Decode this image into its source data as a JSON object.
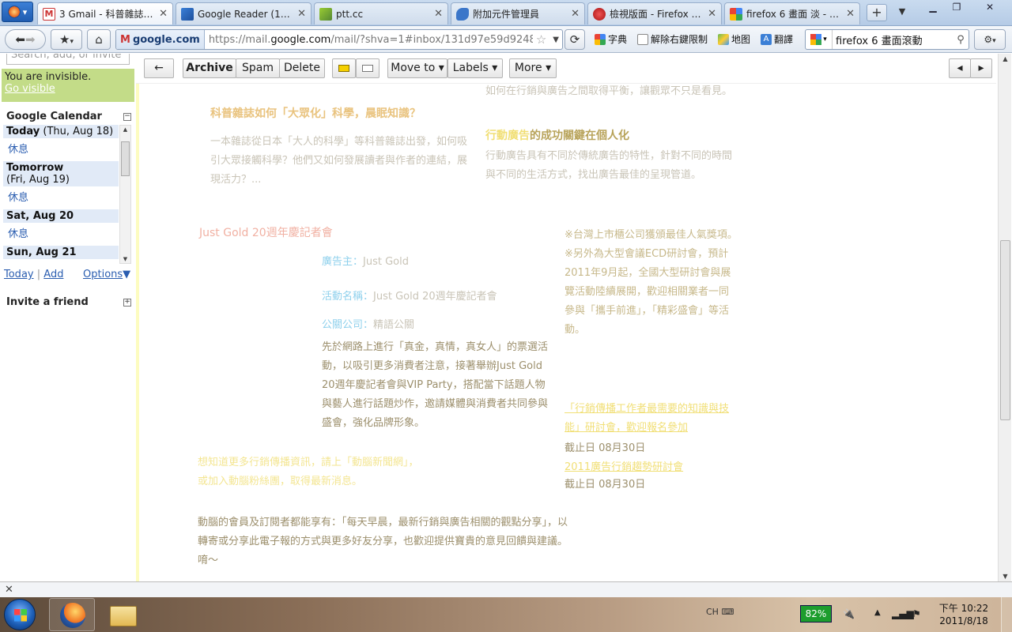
{
  "browser": {
    "menu_label": "▾",
    "tabs": [
      {
        "title": "Gmail - 科普雜誌如何...",
        "badge": "3",
        "active": true
      },
      {
        "title": "Google Reader (1000...",
        "active": false
      },
      {
        "title": "ptt.cc",
        "active": false
      },
      {
        "title": "附加元件管理員",
        "active": false
      },
      {
        "title": "檢視版面 - Firefox • ...",
        "active": false
      },
      {
        "title": "firefox 6 畫面 淡 - Go...",
        "active": false
      }
    ],
    "new_tab": "+",
    "url_identity": "google.com",
    "url_prefix": "https://mail.",
    "url_domain": "google.com",
    "url_rest": "/mail/?shva=1#inbox/131d97e59d924838",
    "bookmarks": [
      "字典",
      "解除右鍵限制",
      "地图",
      "翻譯"
    ],
    "search_value": "firefox 6 畫面滾動",
    "colors": {
      "accent": "#1f5cb0"
    }
  },
  "sidebar": {
    "chat_search_placeholder": "Search, add, or invite",
    "status_text": "You are invisible.",
    "go_visible": "Go visible",
    "calendar_title": "Google Calendar",
    "agenda": [
      {
        "day_bold": "Today",
        "day_rest": " (Thu, Aug 18)",
        "event": "休息"
      },
      {
        "day_bold": "Tomorrow",
        "day_rest": "(Fri, Aug 19)",
        "event": "休息"
      },
      {
        "day_bold": "Sat, Aug 20",
        "day_rest": "",
        "event": "休息"
      },
      {
        "day_bold": "Sun, Aug 21",
        "day_rest": "",
        "event": ""
      }
    ],
    "today_link": "Today",
    "add_link": "Add",
    "options_link": "Options",
    "invite_title": "Invite a friend"
  },
  "toolbar": {
    "back": "←",
    "archive": "Archive",
    "spam": "Spam",
    "delete": "Delete",
    "move_to": "Move to ▾",
    "labels": "Labels ▾",
    "more": "More ▾",
    "prev": "◂",
    "next": "▸"
  },
  "message": {
    "headline1": "科普雜誌如何「大眾化」科學，晨眠知識？",
    "para1": "一本雜誌從日本「大人的科學」等科普雜誌出發，如何吸引大眾接觸科學？他們又如何發展讀者與作者的連結，展現活力？...",
    "col2_top": "如何在行銷與廣告之間取得平衡，讓觀眾不只是看見。",
    "headline2_prefix": "行動廣告",
    "headline2_suffix": "的成功關鍵在個人化",
    "para2": "行動廣告具有不同於傳統廣告的特性，針對不同的時間與不同的生活方式，找出廣告最佳的呈現管道。",
    "event_title": "Just Gold 20週年慶記者會",
    "advertiser_label": "廣告主：",
    "advertiser": "Just Gold",
    "campaign_label": "活動名稱：",
    "campaign": "Just Gold 20週年慶記者會",
    "agency_label": "公關公司：",
    "agency": "精語公關",
    "event_body": "先於網路上進行「真金，真情，真女人」的票選活動，以吸引更多消費者注意，接著舉辦Just Gold 20週年慶記者會與VIP Party，搭配當下話題人物與藝人進行話題炒作，邀請媒體與消費者共同參與盛會，強化品牌形象。",
    "right_col": "※台灣上市櫃公司獲頒最佳人氣獎項。※另外為大型會議ECD研討會，預計2011年9月起，全國大型研討會與展覽活動陸續展開，歡迎相關業者一同參與「攜手前進」，「精彩盛會」等活動。",
    "link1": "「行銷傳播工作者最需要的知識與技能」研討會，歡迎報名參加",
    "deadline1": "截止日 08月30日",
    "link2": "2011廣告行銷趨勢研討會",
    "deadline2": "截止日 08月30日",
    "bottom_links": "想知道更多行銷傳播資訊，請上「動腦新聞網」，或加入動腦粉絲團，取得最新消息。",
    "closing": "動腦的會員及訂閱者都能享有：「每天早晨，最新行銷與廣告相關的觀點分享」，以轉寄或分享此電子報的方式與更多好友分享，也歡迎提供寶貴的意見回饋與建議。",
    "closing_end": "唷～"
  },
  "taskbar": {
    "ime": "CH",
    "battery": "82%",
    "clock_time": "下午 10:22",
    "clock_date": "2011/8/18"
  }
}
